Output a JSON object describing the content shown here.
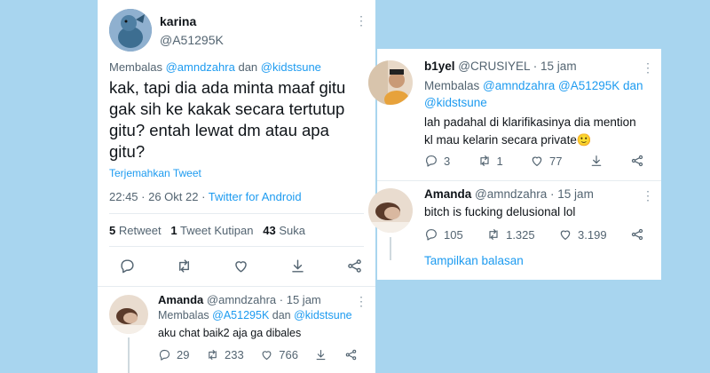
{
  "main_tweet": {
    "author_name": "karina",
    "author_handle": "@A51295K",
    "reply_prefix": "Membalas",
    "reply_user1": "@amndzahra",
    "reply_conj": "dan",
    "reply_user2": "@kidstsune",
    "text_line1": "kak, tapi dia ada minta maaf gitu",
    "text_line2": "gak sih ke kakak secara tertutup",
    "text_line3": "gitu? entah lewat dm atau apa",
    "text_line4": "gitu?",
    "translate": "Terjemahkan Tweet",
    "timestamp": "22:45 · 26 Okt 22 · ",
    "source": "Twitter for Android",
    "retweets_count": "5",
    "retweets_label": "Retweet",
    "quotes_count": "1",
    "quotes_label": "Tweet Kutipan",
    "likes_count": "43",
    "likes_label": "Suka"
  },
  "reply_left": {
    "author_name": "Amanda",
    "author_handle": "@amndzahra",
    "time": "· 15 jam",
    "reply_prefix": "Membalas",
    "reply_user1": "@A51295K",
    "reply_conj": "dan",
    "reply_user2": "@kidstsune",
    "text": "aku chat baik2 aja ga dibales",
    "replies": "29",
    "retweets": "233",
    "likes": "766"
  },
  "reply_right1": {
    "author_name": "b1yel",
    "author_handle": "@CRUSIYEL",
    "time": "· 15 jam",
    "reply_prefix": "Membalas",
    "reply_users1": "@amndzahra @A51295K dan",
    "reply_users2": "@kidstsune",
    "text_line1": "lah padahal di klarifikasinya dia mention",
    "text_line2": "kl mau kelarin secara private",
    "emoji": "🙂",
    "replies": "3",
    "retweets": "1",
    "likes": "77"
  },
  "reply_right2": {
    "author_name": "Amanda",
    "author_handle": "@amndzahra",
    "time": "· 15 jam",
    "text": "bitch is fucking delusional lol",
    "replies": "105",
    "retweets": "1.325",
    "likes": "3.199",
    "show_replies": "Tampilkan balasan"
  },
  "colors": {
    "background": "#a8d5ef",
    "link_blue": "#1d9bf0",
    "muted": "#536471"
  }
}
